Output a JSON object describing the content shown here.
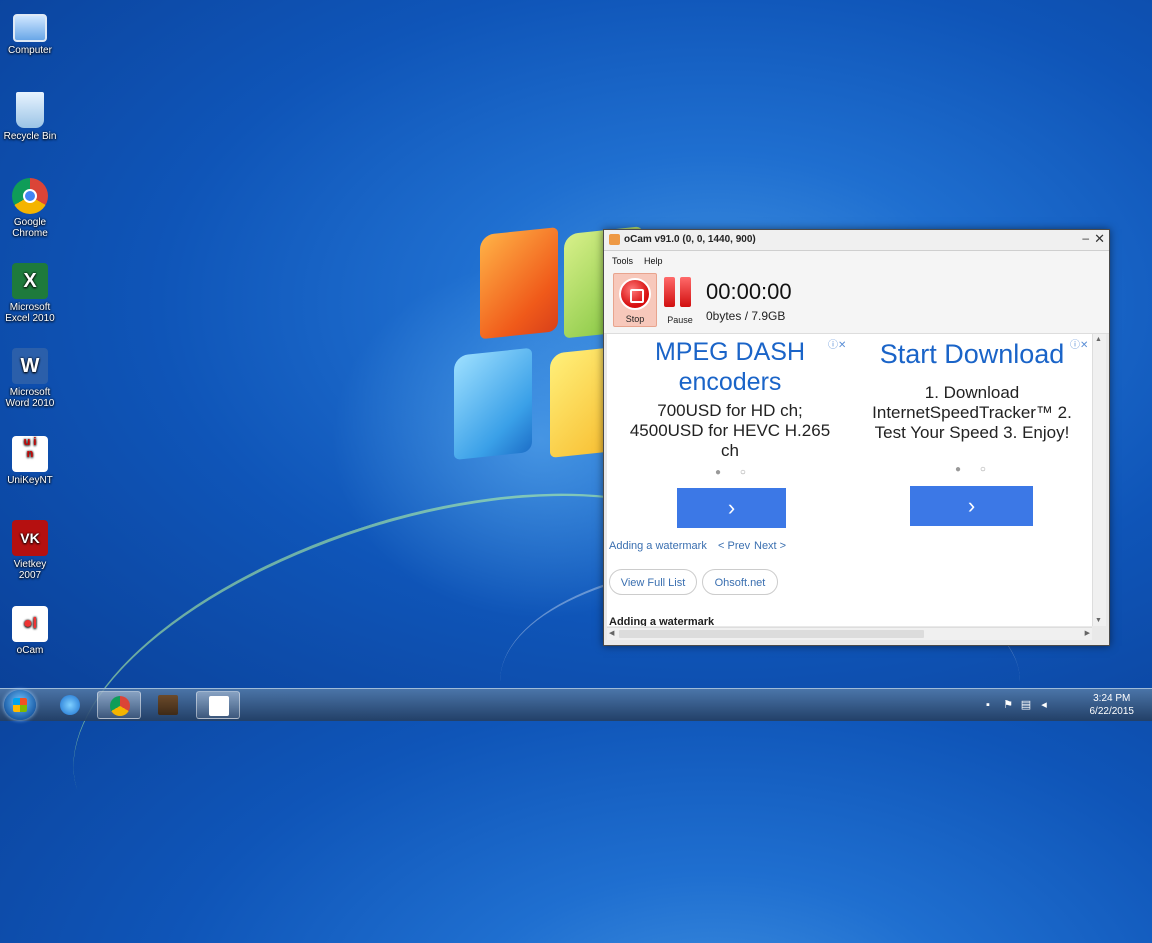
{
  "desktop": {
    "icons": [
      {
        "label": "Computer",
        "icon": "computer-icon"
      },
      {
        "label": "Recycle Bin",
        "icon": "recycle-bin-icon"
      },
      {
        "label": "Google Chrome",
        "icon": "chrome-icon"
      },
      {
        "label": "Microsoft Excel 2010",
        "icon": "excel-icon"
      },
      {
        "label": "Microsoft Word 2010",
        "icon": "word-icon"
      },
      {
        "label": "UniKeyNT",
        "icon": "unikey-icon"
      },
      {
        "label": "Vietkey 2007",
        "icon": "vietkey-icon"
      },
      {
        "label": "oCam",
        "icon": "ocam-icon"
      }
    ]
  },
  "window": {
    "title": "oCam v91.0 (0, 0, 1440, 900)",
    "menu": [
      "Tools",
      "Help"
    ],
    "toolbar": {
      "stop_label": "Stop",
      "pause_label": "Pause",
      "timer": "00:00:00",
      "size": "0bytes / 7.9GB"
    },
    "ads": [
      {
        "headline_1": "MPEG DASH",
        "headline_2": "encoders",
        "body_1": "700USD for HD ch;",
        "body_2": "4500USD for HEVC H.265",
        "body_3": "ch",
        "dots": "● ○",
        "button": "›"
      },
      {
        "headline_1": "Start Download",
        "body_1": "1. Download",
        "body_2": "InternetSpeedTracker™ 2.",
        "body_3": "Test Your Speed 3. Enjoy!",
        "dots": "● ○",
        "button": "›"
      }
    ],
    "links": {
      "watermark": "Adding a watermark",
      "prev": "< Prev",
      "next": "Next >",
      "view_full_list": "View Full List",
      "ohsoft": "Ohsoft.net",
      "section_title": "Adding a watermark"
    }
  },
  "taskbar": {
    "items": [
      "ie-icon",
      "chrome-icon",
      "minecraft-icon",
      "ocam-icon"
    ],
    "clock_time": "3:24 PM",
    "clock_date": "6/22/2015"
  },
  "colors": {
    "ad_blue": "#1a64c8",
    "button_blue": "#3c78e6",
    "record_red": "#d70f0f"
  }
}
